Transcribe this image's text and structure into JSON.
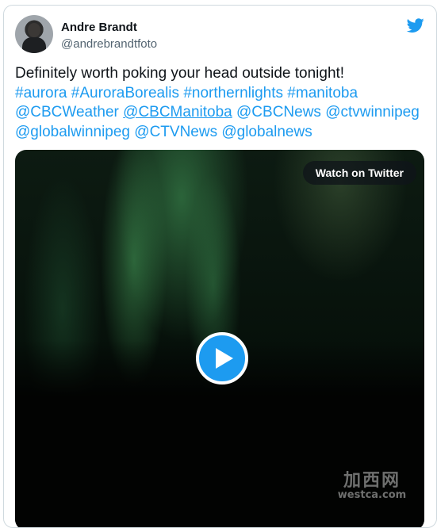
{
  "author": {
    "display_name": "Andre Brandt",
    "handle": "@andrebrandtfoto"
  },
  "tweet": {
    "text_line1": "Definitely worth poking your head outside tonight!",
    "hashtags": [
      "#aurora",
      "#AuroraBorealis",
      "#northernlights",
      "#manitoba"
    ],
    "mentions_line1": [
      "@CBCWeather",
      "@CBCManitoba",
      "@CBCNews",
      "@ctvwinnipeg"
    ],
    "mentions_line2": [
      "@globalwinnipeg",
      "@CTVNews",
      "@globalnews"
    ]
  },
  "media": {
    "watch_label": "Watch on Twitter"
  },
  "watermark": {
    "cn": "加西网",
    "en": "westca.com"
  },
  "icons": {
    "brand": "twitter-bird-icon",
    "play": "play-icon"
  },
  "colors": {
    "link": "#1d9bf0",
    "text": "#0f1419",
    "secondary": "#536471"
  }
}
